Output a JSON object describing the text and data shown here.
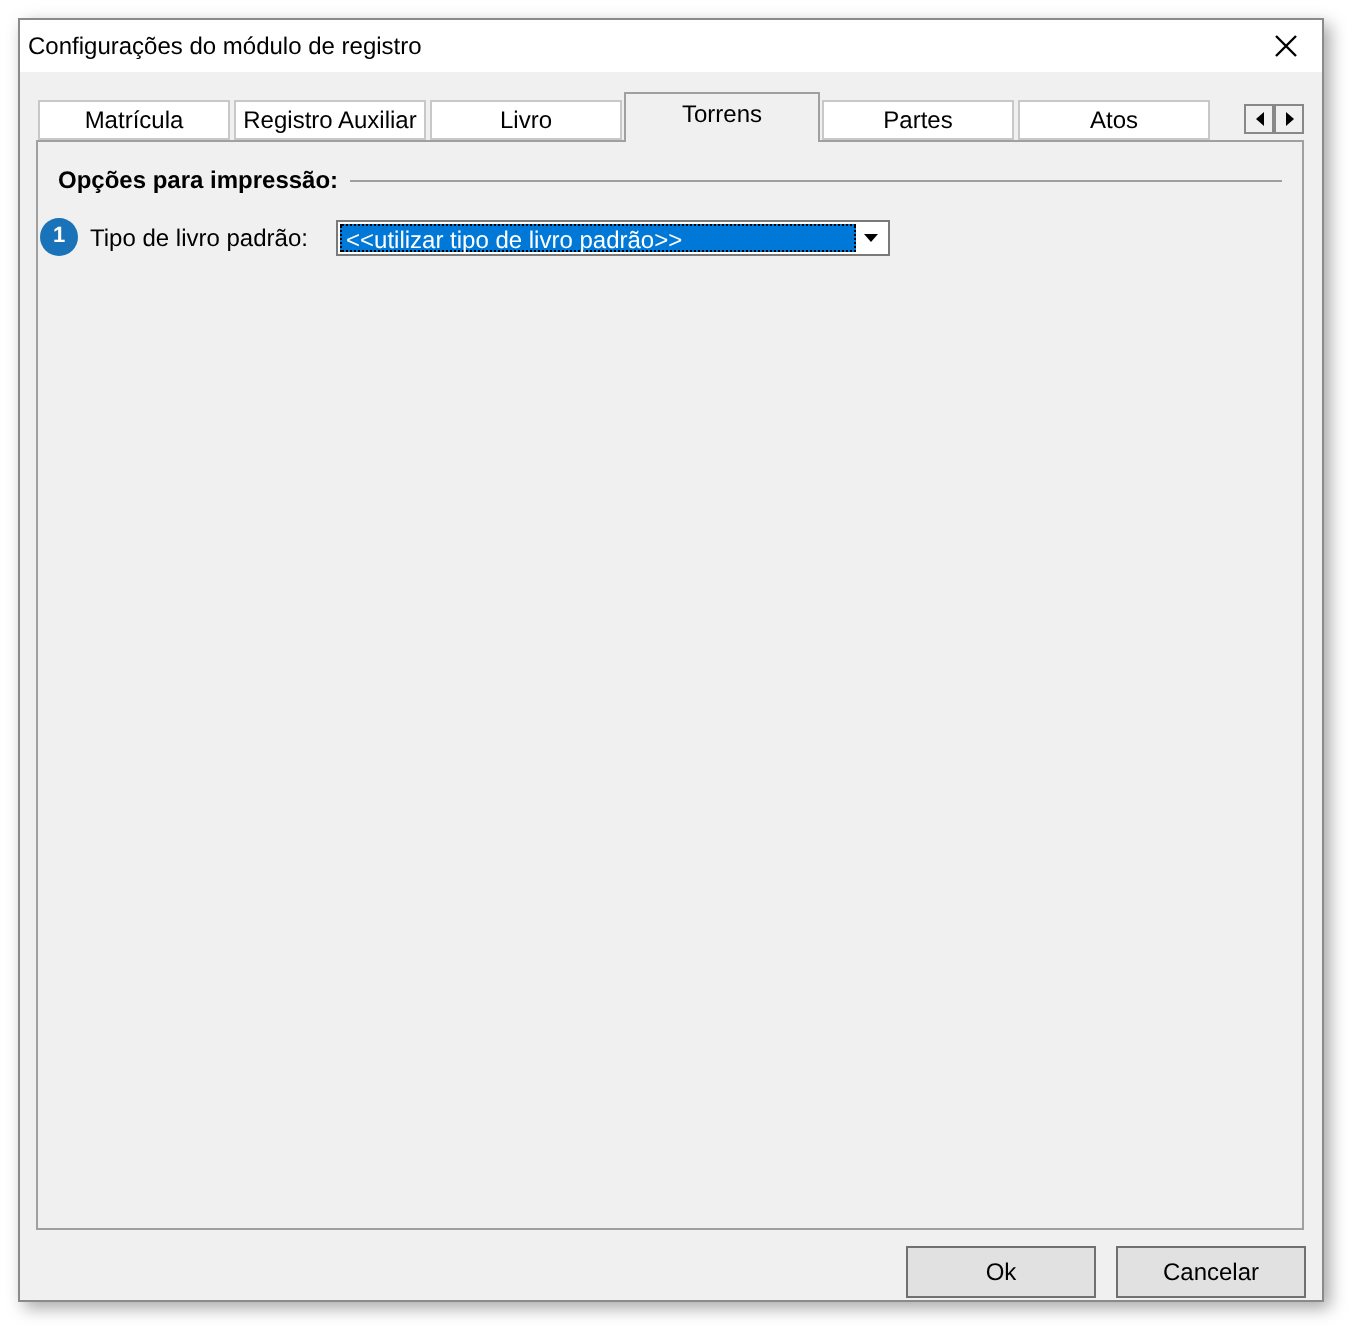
{
  "window": {
    "title": "Configurações do módulo de registro"
  },
  "tabs": [
    {
      "label": "Matrícula",
      "selected": false
    },
    {
      "label": "Registro Auxiliar",
      "selected": false
    },
    {
      "label": "Livro",
      "selected": false
    },
    {
      "label": "Torrens",
      "selected": true
    },
    {
      "label": "Partes",
      "selected": false
    },
    {
      "label": "Atos",
      "selected": false
    }
  ],
  "group": {
    "title": "Opções para impressão:"
  },
  "fields": [
    {
      "badge": "1",
      "label": "Tipo de livro padrão:",
      "value": "<<utilizar tipo de livro padrão>>"
    }
  ],
  "buttons": [
    "Ok",
    "Cancelar"
  ]
}
